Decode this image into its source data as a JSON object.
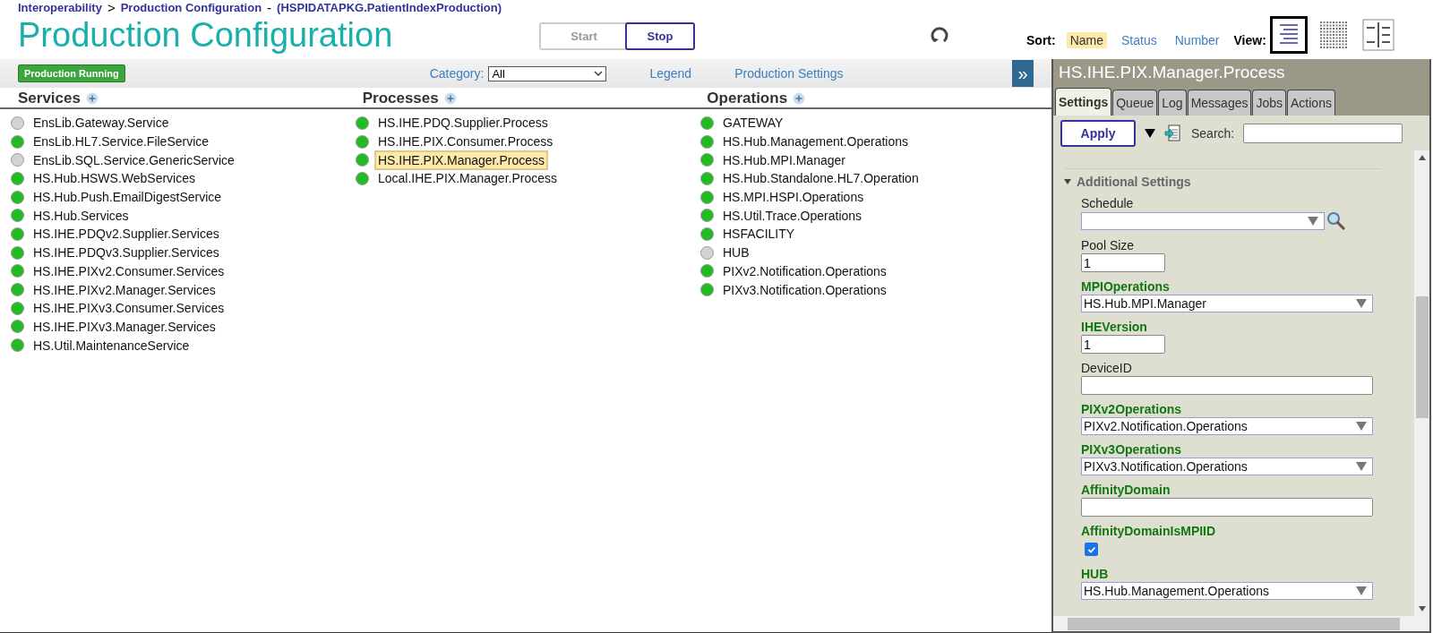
{
  "breadcrumb": {
    "items": [
      "Interoperability",
      "Production Configuration"
    ],
    "separator": ">",
    "context_separator": "-",
    "context": "(HSPIDATAPKG.PatientIndexProduction)"
  },
  "title": "Production Configuration",
  "controls": [
    {
      "label": "Start",
      "disabled": true
    },
    {
      "label": "Stop",
      "disabled": false
    }
  ],
  "sort": {
    "label": "Sort:",
    "options": [
      {
        "label": "Name",
        "selected": true
      },
      {
        "label": "Status",
        "selected": false
      },
      {
        "label": "Number",
        "selected": false
      }
    ]
  },
  "view": {
    "label": "View:",
    "options": [
      {
        "kind": "list",
        "selected": true
      },
      {
        "kind": "grid",
        "selected": false
      },
      {
        "kind": "split",
        "selected": false
      }
    ]
  },
  "toolbar": {
    "status_badge": "Production Running",
    "category_label": "Category:",
    "category_value": "All",
    "links": [
      "Legend",
      "Production Settings"
    ],
    "collapse_button": "»"
  },
  "columns": [
    {
      "title": "Services",
      "items": [
        {
          "name": "EnsLib.Gateway.Service",
          "color": "#d3d3d3",
          "selected": false
        },
        {
          "name": "EnsLib.HL7.Service.FileService",
          "color": "#22bb22",
          "selected": false
        },
        {
          "name": "EnsLib.SQL.Service.GenericService",
          "color": "#d3d3d3",
          "selected": false
        },
        {
          "name": "HS.Hub.HSWS.WebServices",
          "color": "#22bb22",
          "selected": false
        },
        {
          "name": "HS.Hub.Push.EmailDigestService",
          "color": "#22bb22",
          "selected": false
        },
        {
          "name": "HS.Hub.Services",
          "color": "#22bb22",
          "selected": false
        },
        {
          "name": "HS.IHE.PDQv2.Supplier.Services",
          "color": "#22bb22",
          "selected": false
        },
        {
          "name": "HS.IHE.PDQv3.Supplier.Services",
          "color": "#22bb22",
          "selected": false
        },
        {
          "name": "HS.IHE.PIXv2.Consumer.Services",
          "color": "#22bb22",
          "selected": false
        },
        {
          "name": "HS.IHE.PIXv2.Manager.Services",
          "color": "#22bb22",
          "selected": false
        },
        {
          "name": "HS.IHE.PIXv3.Consumer.Services",
          "color": "#22bb22",
          "selected": false
        },
        {
          "name": "HS.IHE.PIXv3.Manager.Services",
          "color": "#22bb22",
          "selected": false
        },
        {
          "name": "HS.Util.MaintenanceService",
          "color": "#22bb22",
          "selected": false
        }
      ]
    },
    {
      "title": "Processes",
      "items": [
        {
          "name": "HS.IHE.PDQ.Supplier.Process",
          "color": "#22bb22",
          "selected": false
        },
        {
          "name": "HS.IHE.PIX.Consumer.Process",
          "color": "#22bb22",
          "selected": false
        },
        {
          "name": "HS.IHE.PIX.Manager.Process",
          "color": "#22bb22",
          "selected": true
        },
        {
          "name": "Local.IHE.PIX.Manager.Process",
          "color": "#22bb22",
          "selected": false
        }
      ]
    },
    {
      "title": "Operations",
      "items": [
        {
          "name": "GATEWAY",
          "color": "#22bb22",
          "selected": false
        },
        {
          "name": "HS.Hub.Management.Operations",
          "color": "#22bb22",
          "selected": false
        },
        {
          "name": "HS.Hub.MPI.Manager",
          "color": "#22bb22",
          "selected": false
        },
        {
          "name": "HS.Hub.Standalone.HL7.Operation",
          "color": "#22bb22",
          "selected": false
        },
        {
          "name": "HS.MPI.HSPI.Operations",
          "color": "#22bb22",
          "selected": false
        },
        {
          "name": "HS.Util.Trace.Operations",
          "color": "#22bb22",
          "selected": false
        },
        {
          "name": "HSFACILITY",
          "color": "#22bb22",
          "selected": false
        },
        {
          "name": "HUB",
          "color": "#d3d3d3",
          "selected": false
        },
        {
          "name": "PIXv2.Notification.Operations",
          "color": "#22bb22",
          "selected": false
        },
        {
          "name": "PIXv3.Notification.Operations",
          "color": "#22bb22",
          "selected": false
        }
      ]
    }
  ],
  "panel": {
    "title": "HS.IHE.PIX.Manager.Process",
    "tabs": [
      {
        "label": "Settings",
        "selected": true
      },
      {
        "label": "Queue",
        "selected": false
      },
      {
        "label": "Log",
        "selected": false
      },
      {
        "label": "Messages",
        "selected": false
      },
      {
        "label": "Jobs",
        "selected": false
      },
      {
        "label": "Actions",
        "selected": false
      }
    ],
    "apply_button": "Apply",
    "search_label": "Search:",
    "section": {
      "title": "Additional Settings",
      "expanded": true
    },
    "fields": [
      {
        "kind": "lookup",
        "label": "Schedule",
        "required": false
      },
      {
        "kind": "short",
        "label": "Pool Size",
        "required": false,
        "value": "1"
      },
      {
        "kind": "select",
        "label": "MPIOperations",
        "required": true,
        "value": "HS.Hub.MPI.Manager"
      },
      {
        "kind": "short",
        "label": "IHEVersion",
        "required": true,
        "value": "1"
      },
      {
        "kind": "text",
        "label": "DeviceID",
        "required": false
      },
      {
        "kind": "select",
        "label": "PIXv2Operations",
        "required": true,
        "value": "PIXv2.Notification.Operations"
      },
      {
        "kind": "select",
        "label": "PIXv3Operations",
        "required": true,
        "value": "PIXv3.Notification.Operations"
      },
      {
        "kind": "text",
        "label": "AffinityDomain",
        "required": true
      },
      {
        "kind": "checkbox",
        "label": "AffinityDomainIsMPIID",
        "required": true,
        "checked": true
      },
      {
        "kind": "select",
        "label": "HUB",
        "required": true,
        "value": "HS.Hub.Management.Operations"
      }
    ]
  }
}
